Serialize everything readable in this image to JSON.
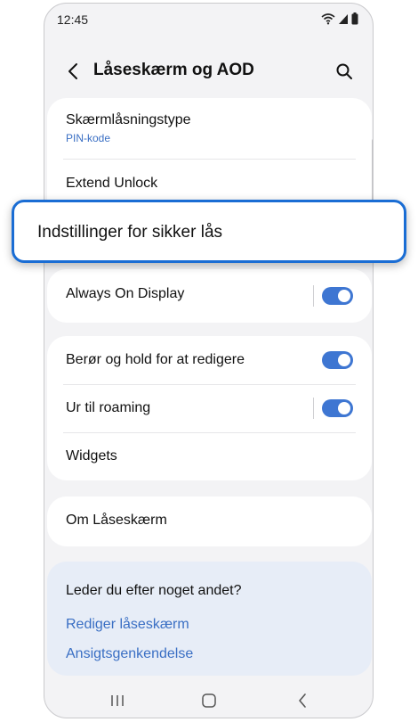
{
  "status_bar": {
    "time": "12:45",
    "icons": [
      "wifi-icon",
      "signal-icon",
      "battery-icon"
    ]
  },
  "app_bar": {
    "title": "Låseskærm og AOD",
    "back_icon": "chevron-left-icon",
    "search_icon": "search-icon"
  },
  "lock_card": {
    "lock_type": {
      "title": "Skærmlåsningstype",
      "subtitle": "PIN-kode"
    },
    "extend_unlock": "Extend Unlock"
  },
  "highlighted_item": "Indstillinger for sikker lås",
  "aod_card": {
    "always_on_display": "Always On Display",
    "always_on_display_enabled": true
  },
  "edit_card": {
    "touch_hold": "Berør og hold for at redigere",
    "touch_hold_enabled": true,
    "roaming_clock": "Ur til roaming",
    "roaming_clock_enabled": true,
    "widgets": "Widgets"
  },
  "about_card": {
    "about": "Om Låseskærm"
  },
  "suggestions": {
    "title": "Leder du efter noget andet?",
    "links": [
      "Rediger låseskærm",
      "Ansigtsgenkendelse"
    ]
  },
  "nav_bar": {
    "icons": [
      "recent-apps-icon",
      "home-icon",
      "back-icon"
    ]
  },
  "colors": {
    "accent": "#3e76d2",
    "link": "#3a6fc4",
    "highlight_border": "#1a6dd4",
    "background": "#f3f3f5",
    "suggest_background": "#e7edf7"
  }
}
